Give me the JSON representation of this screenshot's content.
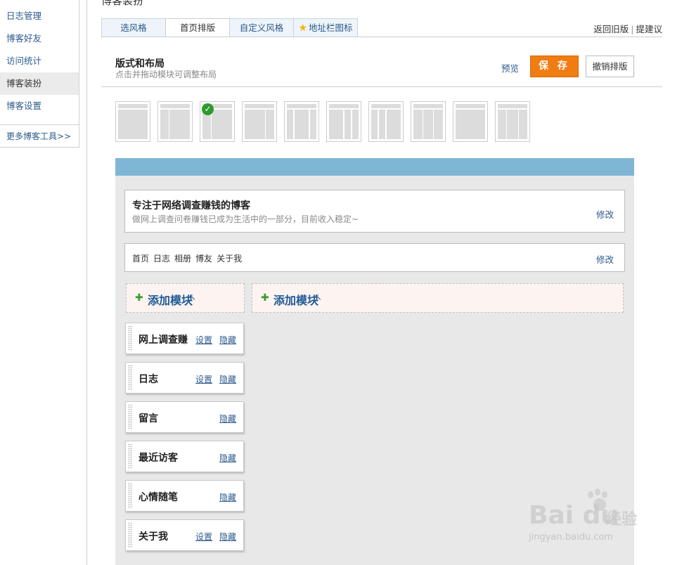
{
  "page": {
    "title": "博客装扮"
  },
  "sidebar": {
    "items": [
      {
        "label": "日志管理"
      },
      {
        "label": "博客好友"
      },
      {
        "label": "访问统计"
      },
      {
        "label": "博客装扮"
      },
      {
        "label": "博客设置"
      }
    ],
    "active_index": 3,
    "more_label": "更多博客工具>>"
  },
  "tabs": {
    "items": [
      {
        "label": "选风格"
      },
      {
        "label": "首页排版"
      },
      {
        "label": "自定义风格"
      },
      {
        "label": "地址栏图标",
        "icon": "star-icon"
      }
    ],
    "active_index": 1,
    "right_links": {
      "old_version": "返回旧版",
      "separator": "|",
      "feedback": "提建议"
    }
  },
  "layout_section": {
    "title": "版式和布局",
    "subtitle": "点击并拖动模块可调整布局",
    "preview_label": "预览",
    "save_label": "保 存",
    "undo_label": "撤销排版",
    "thumbnails_count": 10,
    "selected_thumbnail": 2
  },
  "canvas": {
    "blog_header": {
      "name": "专注于网络调查赚钱的博客",
      "description": "做网上调查问卷赚钱已成为生活中的一部分，目前收入稳定~",
      "edit_label": "修改"
    },
    "nav": {
      "items": [
        "首页",
        "日志",
        "相册",
        "博友",
        "关于我"
      ],
      "edit_label": "修改"
    },
    "add_module_label": "添加模块",
    "widgets": [
      {
        "title": "网上调查赚",
        "settings": "设置",
        "hide": "隐藏"
      },
      {
        "title": "日志",
        "settings": "设置",
        "hide": "隐藏"
      },
      {
        "title": "留言",
        "settings": "",
        "hide": "隐藏"
      },
      {
        "title": "最近访客",
        "settings": "",
        "hide": "隐藏"
      },
      {
        "title": "心情随笔",
        "settings": "",
        "hide": "隐藏"
      },
      {
        "title": "关于我",
        "settings": "设置",
        "hide": "隐藏"
      }
    ]
  },
  "watermark": {
    "logo": "Bai du",
    "text": "经验",
    "url": "jingyan.baidu.com"
  },
  "colors": {
    "accent": "#f07c14",
    "link": "#2c5a8c",
    "bar": "#7fb6d6",
    "canvas": "#e8e8e8"
  }
}
